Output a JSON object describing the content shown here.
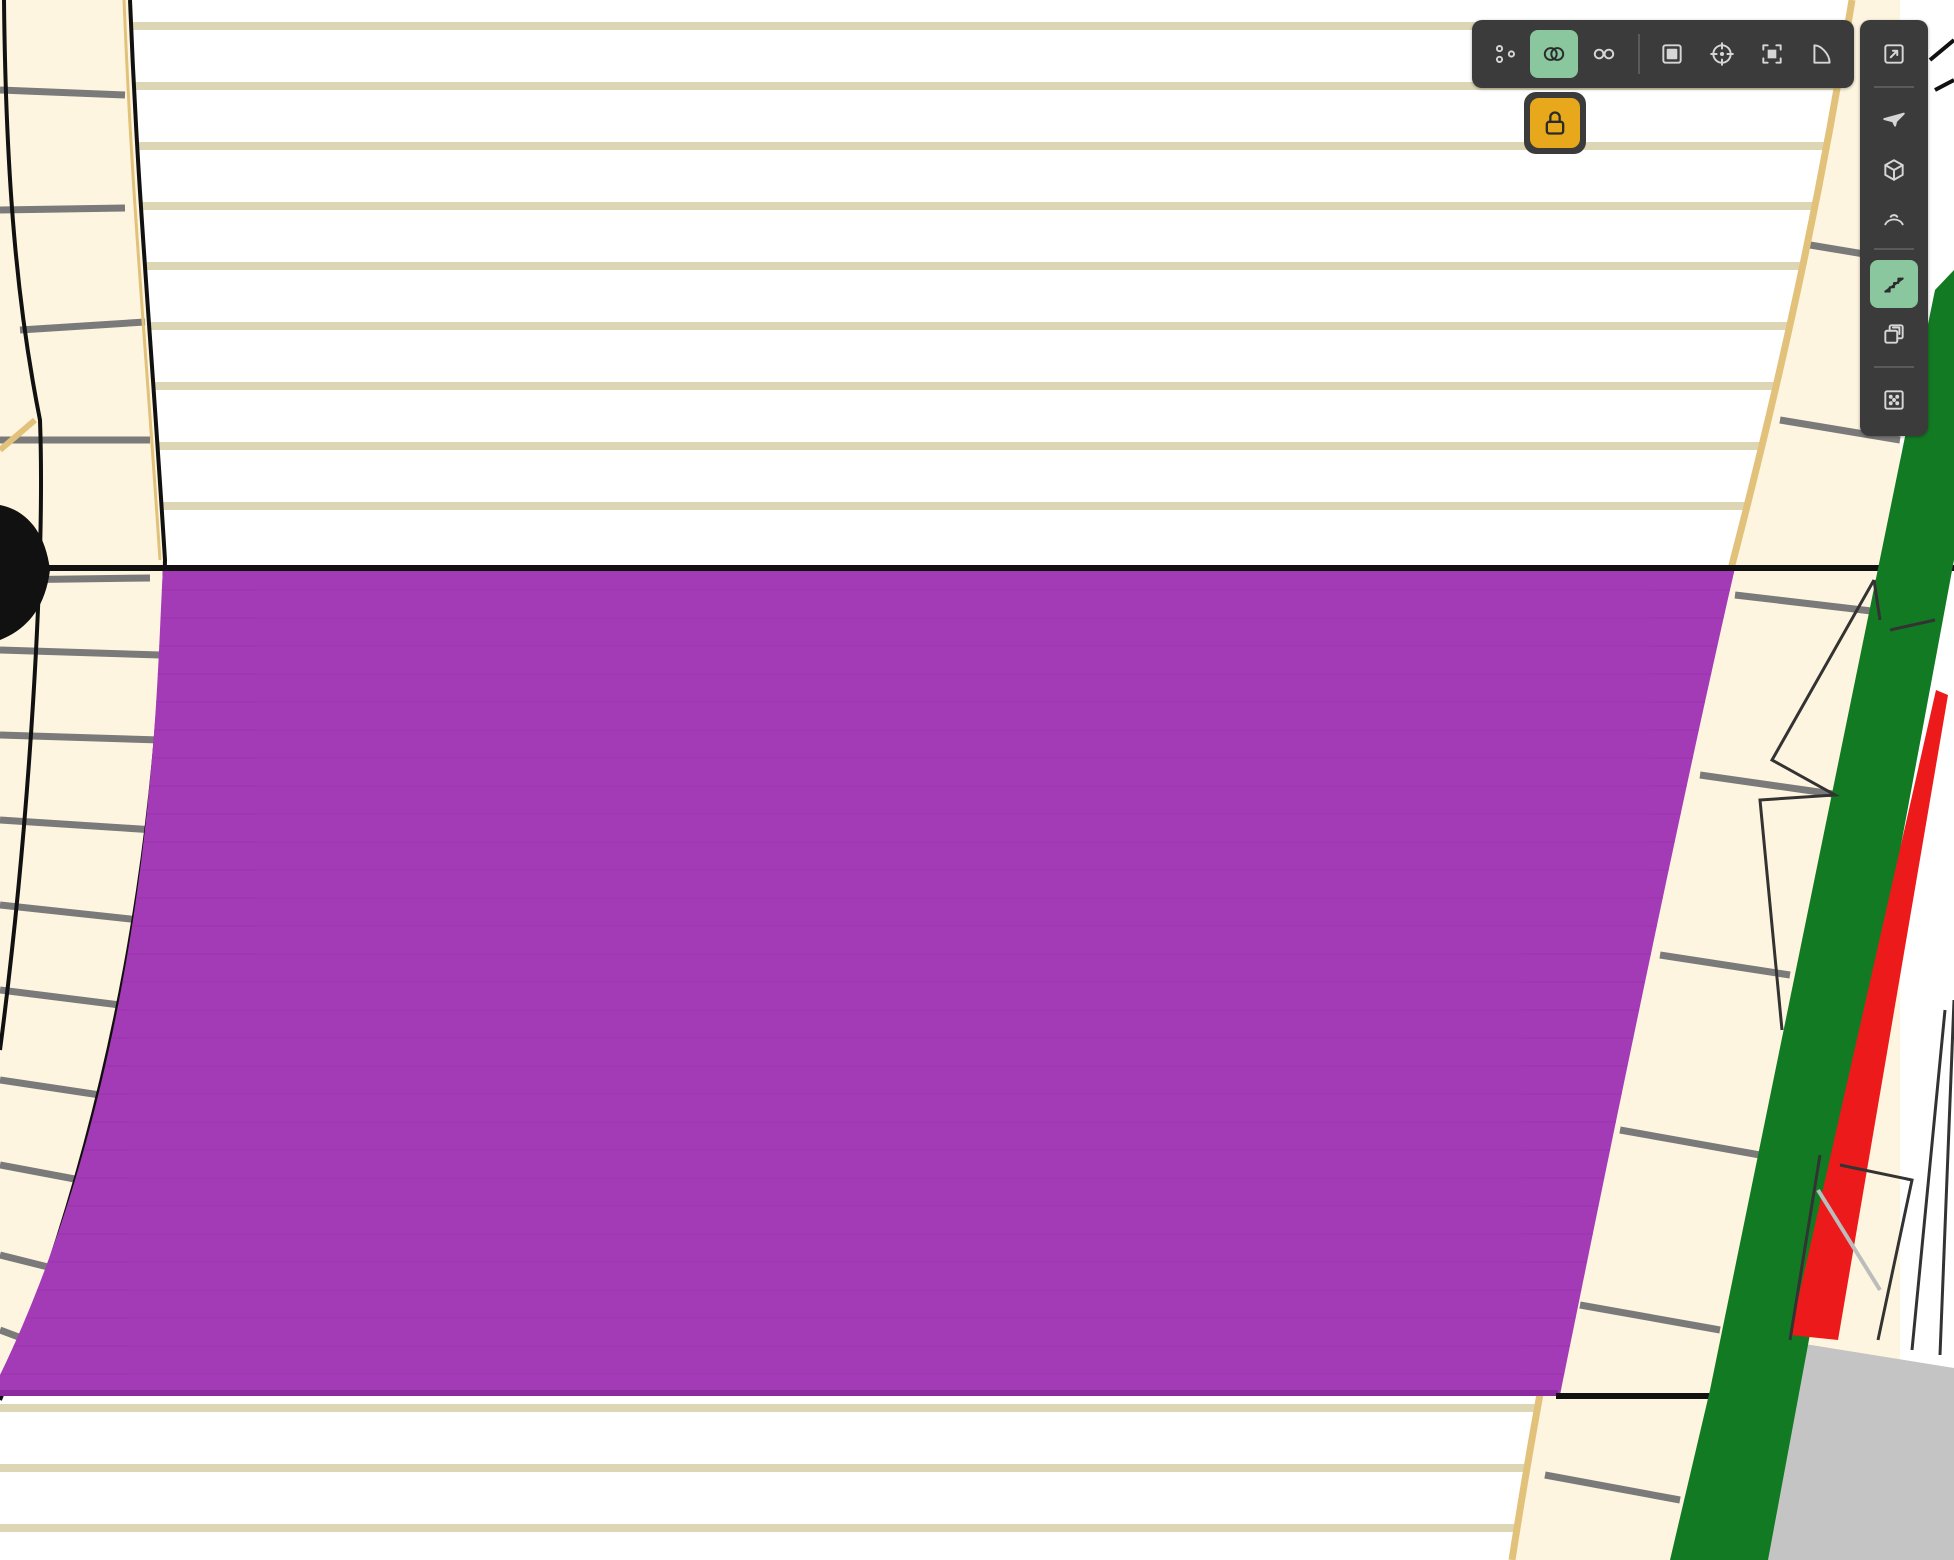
{
  "colors": {
    "canvas_background": "#ffffff",
    "stair_tread_fill": "#fdf5df",
    "stair_tread_line": "#7a7a7a",
    "stair_outline": "#111111",
    "stair_edge_tan": "#e2c27a",
    "floor_line": "#ddd6b4",
    "selected_slab": "#a43bb6",
    "selected_slab_edge": "#8e2aa0",
    "wall_green": "#137a24",
    "wall_red": "#ec1a1a",
    "floor_grey": "#c4c4c4",
    "toolbar_bg": "#3b3b3b",
    "toolbar_icon": "#d6d6d6",
    "toolbar_active": "#8ac79e",
    "lock_accent": "#e7a91b"
  },
  "toolbar_top": {
    "buttons": [
      {
        "icon": "scissors-icon",
        "active": false
      },
      {
        "icon": "intersect-icon",
        "active": true
      },
      {
        "icon": "infinity-icon",
        "active": false
      },
      {
        "icon": "square-stop-icon",
        "active": false
      },
      {
        "icon": "crosshair-icon",
        "active": false
      },
      {
        "icon": "focus-frame-icon",
        "active": false
      },
      {
        "icon": "curve-corner-icon",
        "active": false
      }
    ]
  },
  "toolbar_right": {
    "buttons": [
      {
        "icon": "expand-icon",
        "active": false
      },
      {
        "icon": "plane-icon",
        "active": false
      },
      {
        "icon": "cube-icon",
        "active": false
      },
      {
        "icon": "arc-icon",
        "active": false
      },
      {
        "icon": "stairs-icon",
        "active": true
      },
      {
        "icon": "layers-icon",
        "active": false
      },
      {
        "icon": "grid-dots-icon",
        "active": false
      }
    ]
  },
  "lock_button": {
    "icon": "lock-icon",
    "active": true
  }
}
